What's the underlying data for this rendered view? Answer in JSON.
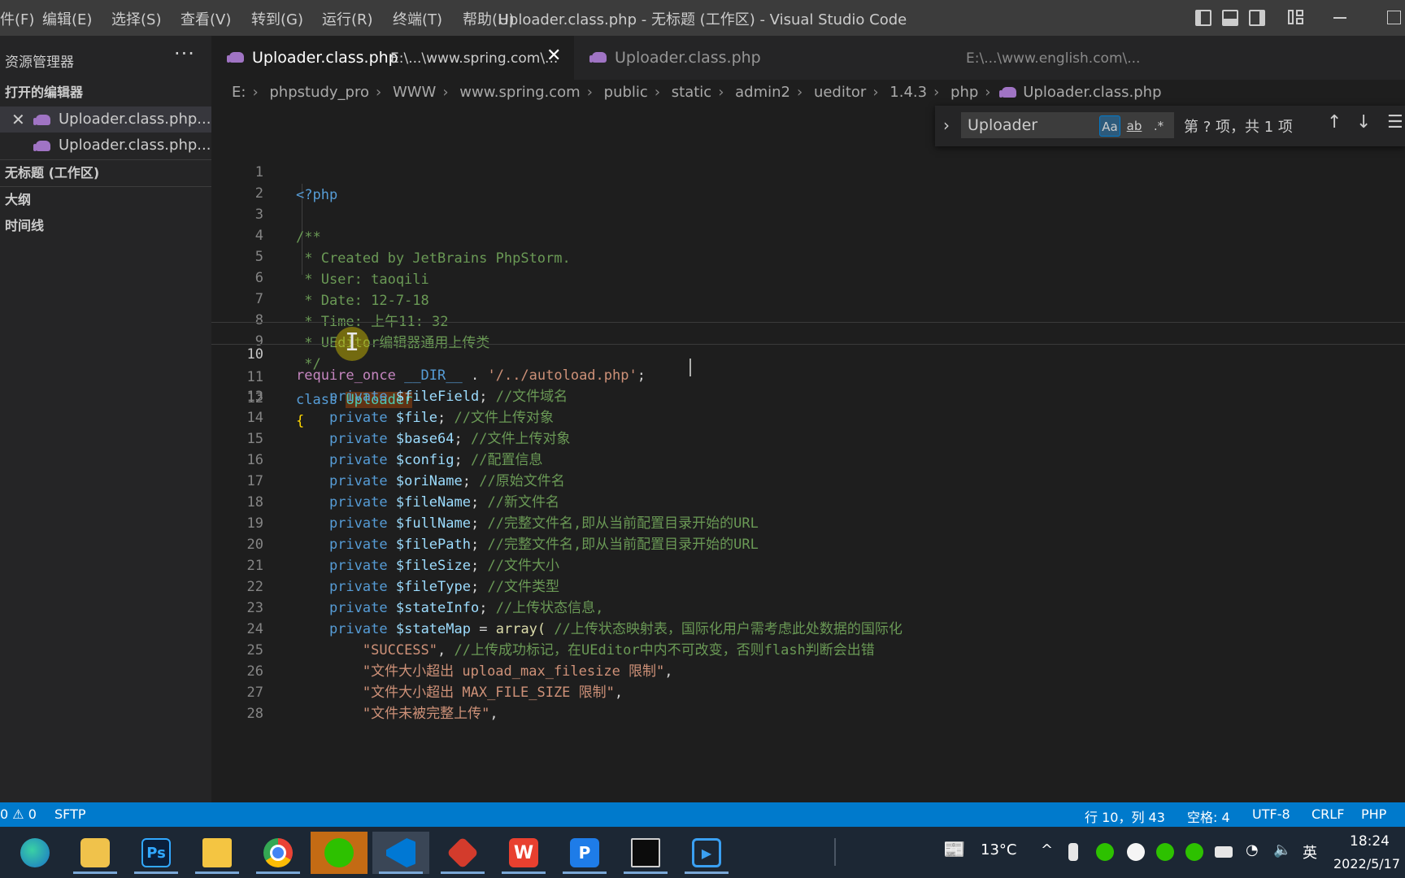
{
  "menu": [
    "件(F)",
    "编辑(E)",
    "选择(S)",
    "查看(V)",
    "转到(G)",
    "运行(R)",
    "终端(T)",
    "帮助(H)"
  ],
  "window_title": "Uploader.class.php - 无标题 (工作区) - Visual Studio Code",
  "sidebar": {
    "title": "资源管理器",
    "more": "···",
    "open_editors_header": "打开的编辑器",
    "open_files": [
      "Uploader.class.php...",
      "Uploader.class.php..."
    ],
    "sections": [
      "无标题 (工作区)",
      "大纲",
      "时间线"
    ]
  },
  "tabs": [
    {
      "label": "Uploader.class.php",
      "path": "E:\\...\\www.spring.com\\..."
    },
    {
      "label": "Uploader.class.php",
      "path": "E:\\...\\www.english.com\\..."
    }
  ],
  "breadcrumb": [
    "E:",
    "phpstudy_pro",
    "WWW",
    "www.spring.com",
    "public",
    "static",
    "admin2",
    "ueditor",
    "1.4.3",
    "php",
    "Uploader.class.php"
  ],
  "find": {
    "query": "Uploader",
    "opt_case": "Aa",
    "opt_word": "ab",
    "opt_regex": ".*",
    "count": "第 ? 项，共 1 项"
  },
  "editor": {
    "current_line": 10,
    "lines": [
      {
        "n": "1"
      },
      {
        "n": "2"
      },
      {
        "n": "3"
      },
      {
        "n": "4"
      },
      {
        "n": "5"
      },
      {
        "n": "6"
      },
      {
        "n": "7"
      },
      {
        "n": "8"
      },
      {
        "n": "9"
      },
      {
        "n": "10"
      },
      {
        "n": "11"
      },
      {
        "n": "12"
      },
      {
        "n": "13"
      },
      {
        "n": "14"
      },
      {
        "n": "15"
      },
      {
        "n": "16"
      },
      {
        "n": "17"
      },
      {
        "n": "18"
      },
      {
        "n": "19"
      },
      {
        "n": "20"
      },
      {
        "n": "21"
      },
      {
        "n": "22"
      },
      {
        "n": "23"
      },
      {
        "n": "24"
      },
      {
        "n": "25"
      },
      {
        "n": "26"
      },
      {
        "n": "27"
      },
      {
        "n": "28"
      }
    ],
    "code": {
      "l1": "<?php",
      "l3": "/**",
      "l4": " * Created by JetBrains PhpStorm.",
      "l5": " * User: taoqili",
      "l6": " * Date: 12-7-18",
      "l7": " * Time: 上午11: 32",
      "l8": " * UEditor编辑器通用上传类",
      "l9": " */",
      "l10_kw": "require_once",
      "l10_const": "__DIR__",
      "l10_op": ".",
      "l10_str": "'/../autoload.php'",
      "l10_end": ";",
      "l11_kw": "class",
      "l11_cls": "Uploader",
      "l12": "{",
      "private": "private",
      "fields": [
        {
          "var": "$fileField",
          "com": "//文件域名"
        },
        {
          "var": "$file",
          "com": "//文件上传对象"
        },
        {
          "var": "$base64",
          "com": "//文件上传对象"
        },
        {
          "var": "$config",
          "com": "//配置信息"
        },
        {
          "var": "$oriName",
          "com": "//原始文件名"
        },
        {
          "var": "$fileName",
          "com": "//新文件名"
        },
        {
          "var": "$fullName",
          "com": "//完整文件名,即从当前配置目录开始的URL"
        },
        {
          "var": "$filePath",
          "com": "//完整文件名,即从当前配置目录开始的URL"
        },
        {
          "var": "$fileSize",
          "com": "//文件大小"
        },
        {
          "var": "$fileType",
          "com": "//文件类型"
        },
        {
          "var": "$stateInfo",
          "com": "//上传状态信息,"
        }
      ],
      "l24_var": "$stateMap",
      "l24_eq": "=",
      "l24_fn": "array(",
      "l24_com": "//上传状态映射表，国际化用户需考虑此处数据的国际化",
      "l25_str": "\"SUCCESS\"",
      "l25_com": "//上传成功标记，在UEditor中内不可改变，否则flash判断会出错",
      "l26_str": "\"文件大小超出 upload_max_filesize 限制\"",
      "l27_str": "\"文件大小超出 MAX_FILE_SIZE 限制\"",
      "l28_str": "\"文件未被完整上传\"",
      "comma": ","
    }
  },
  "statusbar": {
    "problems": "0",
    "warnings": "0",
    "sftp": "SFTP",
    "position": "行 10，列 43",
    "spaces": "空格: 4",
    "encoding": "UTF-8",
    "eol": "CRLF",
    "language": "PHP"
  },
  "taskbar": {
    "weather": "13°C",
    "ime": "英",
    "time": "18:24",
    "date": "2022/5/17"
  },
  "colors": {
    "accent": "#007acc",
    "editor_bg": "#1e1e1e",
    "sidebar_bg": "#252526",
    "taskbar_bg": "#1c2734"
  }
}
